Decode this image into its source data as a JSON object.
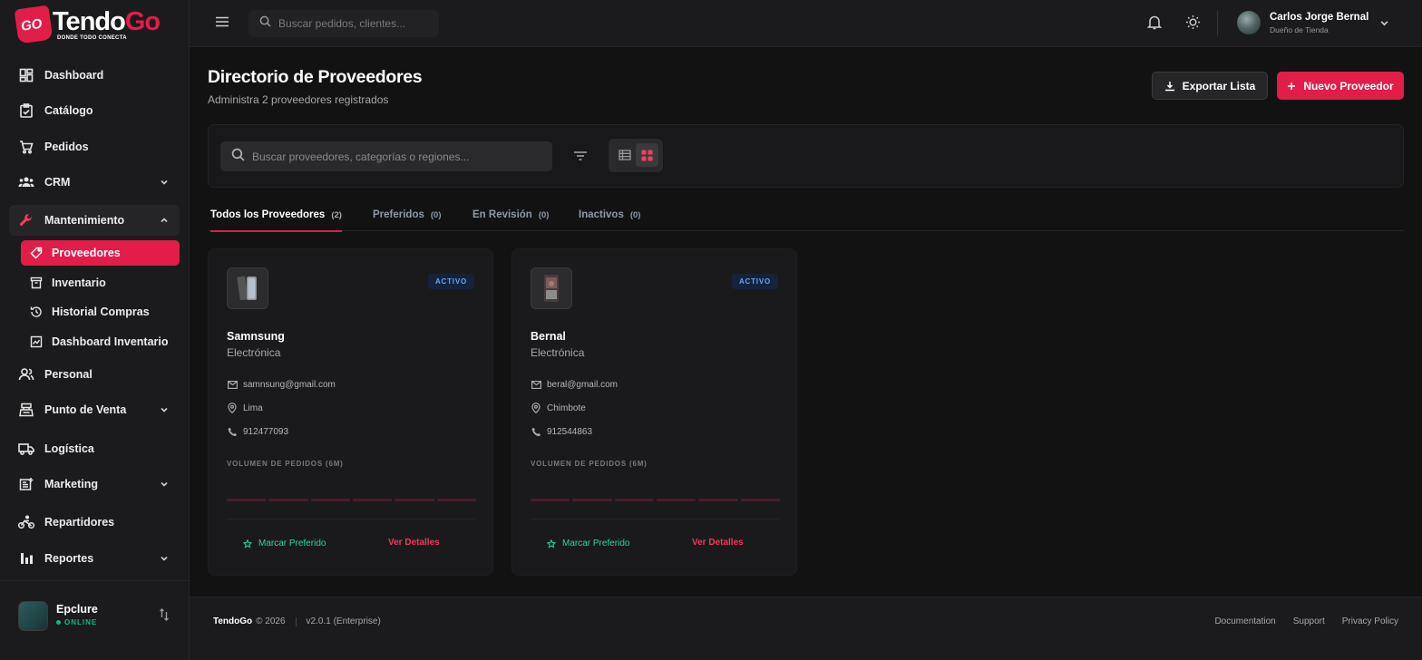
{
  "brand": {
    "logo_part1": "Tendo",
    "logo_part2": "Go",
    "logo_badge": "GO",
    "tagline": "DONDE TODO CONECTA",
    "accent_color": "#e11d48"
  },
  "sidebar": {
    "items": [
      {
        "label": "Dashboard",
        "icon": "dashboard-icon"
      },
      {
        "label": "Catálogo",
        "icon": "clipboard-icon"
      },
      {
        "label": "Pedidos",
        "icon": "cart-icon"
      },
      {
        "label": "CRM",
        "icon": "users-icon"
      },
      {
        "label": "Mantenimiento",
        "icon": "wrench-icon"
      },
      {
        "label": "Personal",
        "icon": "person-icon"
      },
      {
        "label": "Punto de Venta",
        "icon": "register-icon"
      },
      {
        "label": "Logística",
        "icon": "truck-icon"
      },
      {
        "label": "Marketing",
        "icon": "news-icon"
      },
      {
        "label": "Repartidores",
        "icon": "bike-icon"
      },
      {
        "label": "Reportes",
        "icon": "bar-chart-icon"
      }
    ],
    "sub_items": [
      {
        "label": "Proveedores",
        "icon": "tag-icon"
      },
      {
        "label": "Inventario",
        "icon": "archive-icon"
      },
      {
        "label": "Historial Compras",
        "icon": "history-icon"
      },
      {
        "label": "Dashboard Inventario",
        "icon": "trend-icon"
      }
    ],
    "workspace": {
      "name": "Epclure",
      "status": "ONLINE"
    }
  },
  "header": {
    "search_placeholder": "Buscar pedidos, clientes...",
    "user_name": "Carlos Jorge Bernal",
    "user_role": "Dueño de Tienda"
  },
  "page": {
    "title": "Directorio de Proveedores",
    "subtitle": "Administra 2 proveedores registrados",
    "export_label": "Exportar Lista",
    "new_label": "Nuevo Proveedor",
    "search_placeholder": "Buscar proveedores, categorías o regiones..."
  },
  "tabs": [
    {
      "label": "Todos los Proveedores",
      "count": "(2)"
    },
    {
      "label": "Preferidos",
      "count": "(0)"
    },
    {
      "label": "En Revisión",
      "count": "(0)"
    },
    {
      "label": "Inactivos",
      "count": "(0)"
    }
  ],
  "suppliers": [
    {
      "name": "Samnsung",
      "category": "Electrónica",
      "status": "ACTIVO",
      "email": "samnsung@gmail.com",
      "location": "Lima",
      "phone": "912477093",
      "volume_label": "VOLUMEN DE PEDIDOS (6M)",
      "prefer_label": "Marcar Preferido",
      "details_label": "Ver Detalles"
    },
    {
      "name": "Bernal",
      "category": "Electrónica",
      "status": "ACTIVO",
      "email": "beral@gmail.com",
      "location": "Chimbote",
      "phone": "912544863",
      "volume_label": "VOLUMEN DE PEDIDOS (6M)",
      "prefer_label": "Marcar Preferido",
      "details_label": "Ver Detalles"
    }
  ],
  "footer": {
    "brand": "TendoGo",
    "copyright": "© 2026",
    "version": "v2.0.1 (Enterprise)",
    "links": [
      "Documentation",
      "Support",
      "Privacy Policy"
    ]
  }
}
